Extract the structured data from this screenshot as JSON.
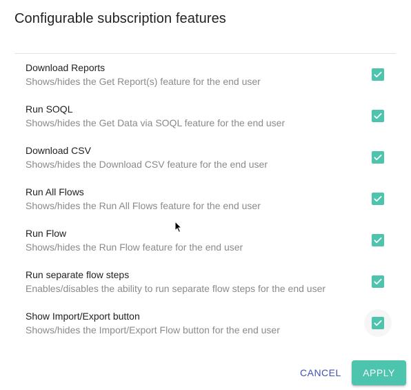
{
  "dialog": {
    "title": "Configurable subscription features"
  },
  "features": [
    {
      "title": "Download Reports",
      "description": "Shows/hides the Get Report(s) feature for the end user",
      "checked": true
    },
    {
      "title": "Run SOQL",
      "description": "Shows/hides the Get Data via SOQL feature for the end user",
      "checked": true
    },
    {
      "title": "Download CSV",
      "description": "Shows/hides the Download CSV feature for the end user",
      "checked": true
    },
    {
      "title": "Run All Flows",
      "description": "Shows/hides the Run All Flows feature for the end user",
      "checked": true
    },
    {
      "title": "Run Flow",
      "description": "Shows/hides the Run Flow feature for the end user",
      "checked": true
    },
    {
      "title": "Run separate flow steps",
      "description": "Enables/disables the ability to run separate flow steps for the end user",
      "checked": true
    },
    {
      "title": "Show Import/Export button",
      "description": "Shows/hides the Import/Export Flow button for the end user",
      "checked": true
    }
  ],
  "footer": {
    "cancel_label": "CANCEL",
    "apply_label": "APPLY"
  },
  "colors": {
    "accent": "#4dc4ae",
    "cancel_text": "#3f51b5"
  }
}
